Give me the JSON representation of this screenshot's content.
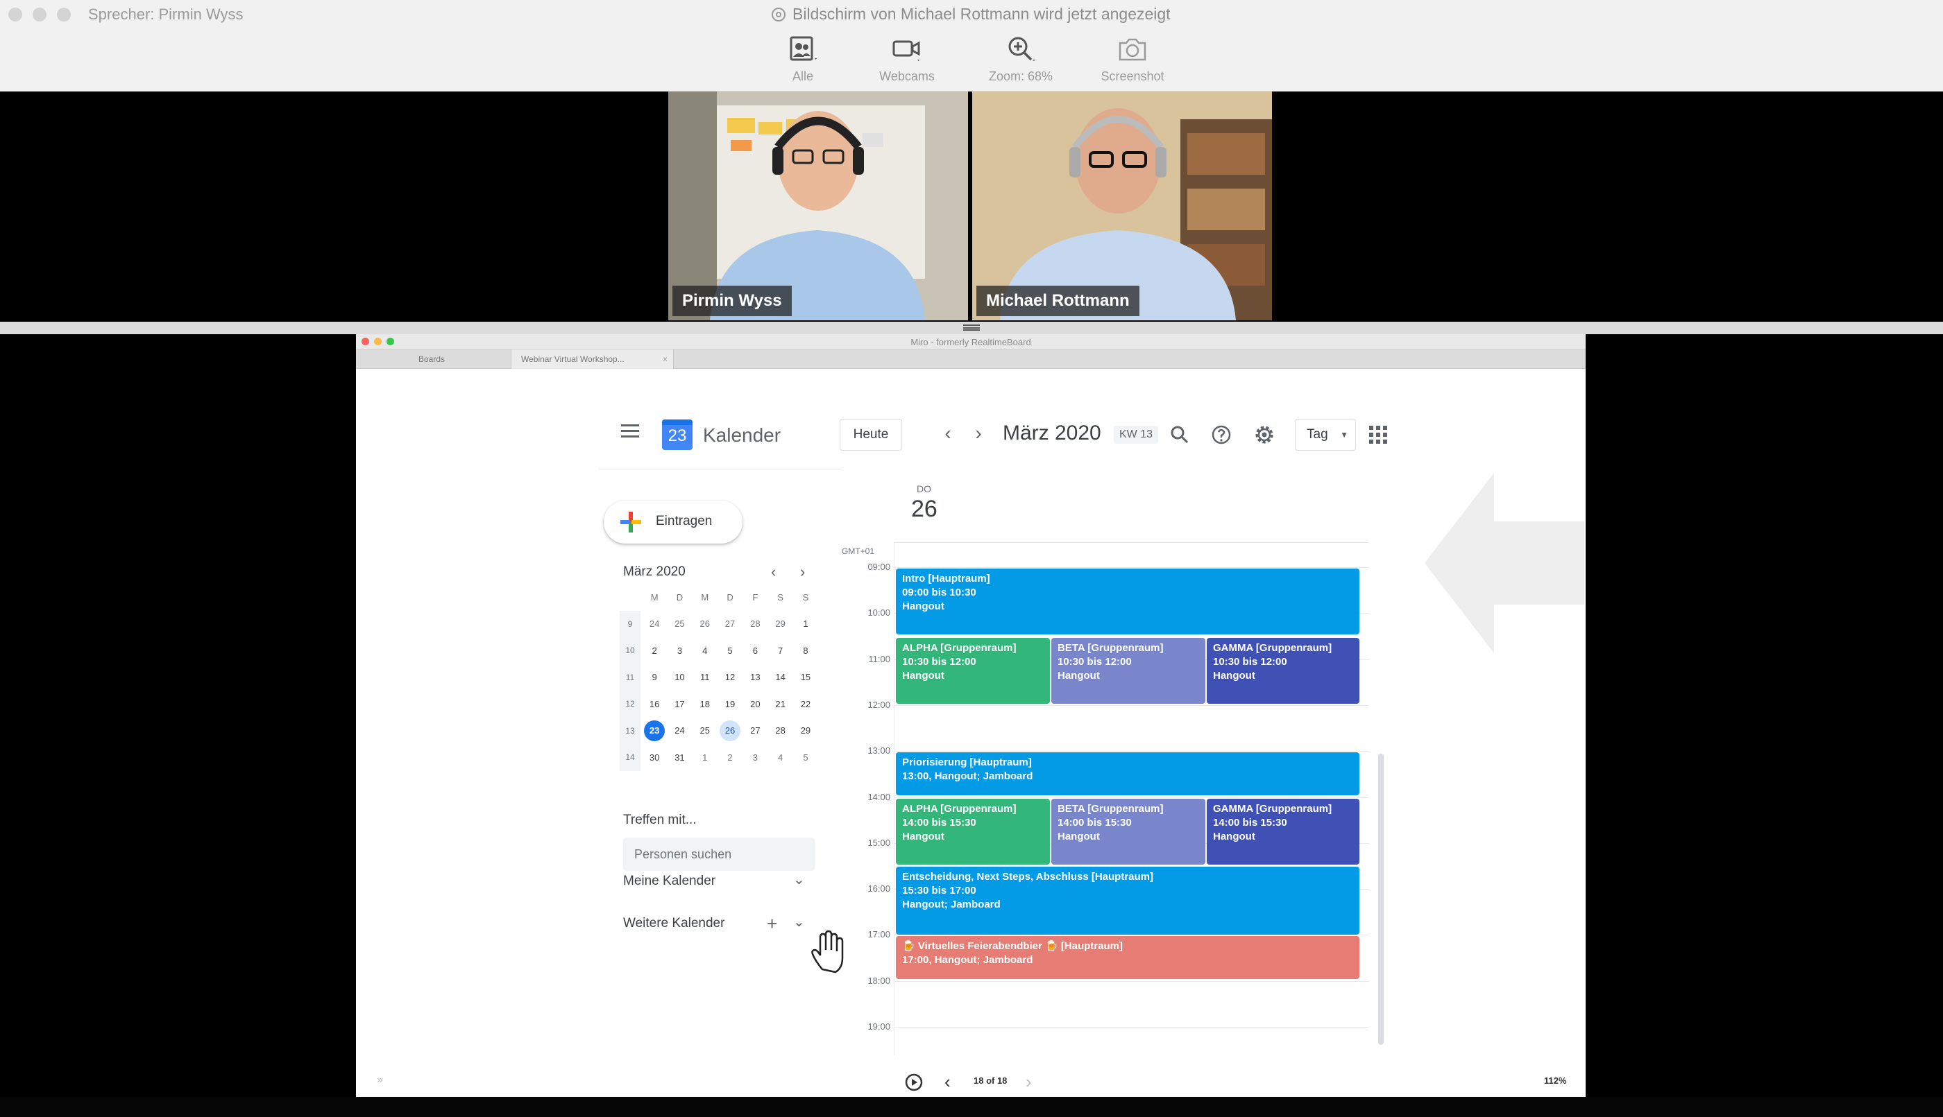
{
  "zoom": {
    "speaker": "Sprecher: Pirmin Wyss",
    "share_title": "Bildschirm von Michael Rottmann wird jetzt angezeigt",
    "toolbar": {
      "alle": "Alle",
      "webcams": "Webcams",
      "zoom": "Zoom: 68%",
      "screenshot": "Screenshot"
    },
    "participants": [
      {
        "name": "Pirmin Wyss",
        "active": true
      },
      {
        "name": "Michael Rottmann",
        "active": false
      }
    ]
  },
  "miro": {
    "window_title": "Miro - formerly RealtimeBoard",
    "tabs": [
      "Boards",
      "Webinar Virtual Workshop..."
    ],
    "tab_close": "×",
    "page": "18 of 18",
    "zoom": "112%",
    "collapse": "»"
  },
  "calendar": {
    "logo_day": "23",
    "app_title": "Kalender",
    "today_button": "Heute",
    "prev": "‹",
    "next": "›",
    "month": "März 2020",
    "week": "KW 13",
    "view": "Tag",
    "create": "Eintragen",
    "mini": {
      "title": "März 2020",
      "dow": [
        "M",
        "D",
        "M",
        "D",
        "F",
        "S",
        "S"
      ],
      "weeks": [
        {
          "wk": "9",
          "days": [
            "24",
            "25",
            "26",
            "27",
            "28",
            "29",
            "1"
          ]
        },
        {
          "wk": "10",
          "days": [
            "2",
            "3",
            "4",
            "5",
            "6",
            "7",
            "8"
          ]
        },
        {
          "wk": "11",
          "days": [
            "9",
            "10",
            "11",
            "12",
            "13",
            "14",
            "15"
          ]
        },
        {
          "wk": "12",
          "days": [
            "16",
            "17",
            "18",
            "19",
            "20",
            "21",
            "22"
          ]
        },
        {
          "wk": "13",
          "days": [
            "23",
            "24",
            "25",
            "26",
            "27",
            "28",
            "29"
          ]
        },
        {
          "wk": "14",
          "days": [
            "30",
            "31",
            "1",
            "2",
            "3",
            "4",
            "5"
          ]
        }
      ]
    },
    "meet_with": "Treffen mit...",
    "search_people_placeholder": "Personen suchen",
    "my_calendars": "Meine Kalender",
    "other_calendars": "Weitere Kalender",
    "day_dow": "DO",
    "day_num": "26",
    "timezone": "GMT+01",
    "hours": [
      "09:00",
      "10:00",
      "11:00",
      "12:00",
      "13:00",
      "14:00",
      "15:00",
      "16:00",
      "17:00",
      "18:00",
      "19:00"
    ],
    "events": [
      {
        "title": "Intro [Hauptraum]",
        "time": "09:00 bis 10:30",
        "loc": "Hangout",
        "color": "#039be5"
      },
      {
        "title": "ALPHA [Gruppenraum]",
        "time": "10:30 bis 12:00",
        "loc": "Hangout",
        "color": "#33b679"
      },
      {
        "title": "BETA [Gruppenraum]",
        "time": "10:30 bis 12:00",
        "loc": "Hangout",
        "color": "#7986cb"
      },
      {
        "title": "GAMMA [Gruppenraum]",
        "time": "10:30 bis 12:00",
        "loc": "Hangout",
        "color": "#3f51b5"
      },
      {
        "title": "Priorisierung [Hauptraum]",
        "time": "13:00, Hangout; Jamboard",
        "loc": "",
        "color": "#039be5"
      },
      {
        "title": "ALPHA [Gruppenraum]",
        "time": "14:00 bis 15:30",
        "loc": "Hangout",
        "color": "#33b679"
      },
      {
        "title": "BETA [Gruppenraum]",
        "time": "14:00 bis 15:30",
        "loc": "Hangout",
        "color": "#7986cb"
      },
      {
        "title": "GAMMA [Gruppenraum]",
        "time": "14:00 bis 15:30",
        "loc": "Hangout",
        "color": "#3f51b5"
      },
      {
        "title": "Entscheidung, Next Steps, Abschluss [Hauptraum]",
        "time": "15:30 bis 17:00",
        "loc": "Hangout; Jamboard",
        "color": "#039be5"
      },
      {
        "title": "🍺 Virtuelles Feierabendbier 🍺 [Hauptraum]",
        "time": "17:00, Hangout; Jamboard",
        "loc": "",
        "color": "#e67c73"
      }
    ]
  }
}
